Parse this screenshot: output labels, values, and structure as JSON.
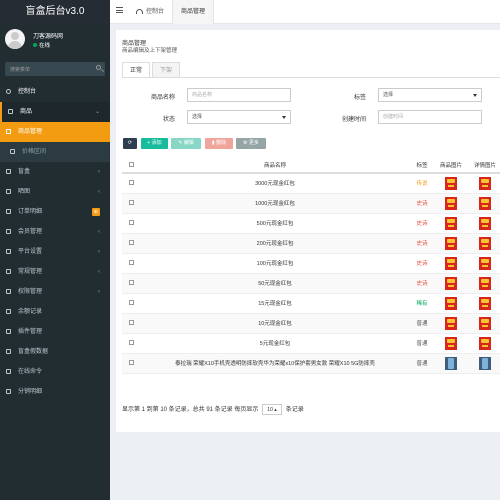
{
  "app": {
    "title": "盲盒后台v3.0"
  },
  "user": {
    "name": "刀客源码网",
    "status": "在线"
  },
  "search": {
    "placeholder": "搜索菜单"
  },
  "sidebar": {
    "items": [
      {
        "label": "控制台"
      },
      {
        "label": "商品"
      },
      {
        "label": "商品管理"
      },
      {
        "label": "价格区间"
      },
      {
        "label": "盲盒"
      },
      {
        "label": "晒图"
      },
      {
        "label": "订单明细",
        "badge": "新"
      },
      {
        "label": "会员管理"
      },
      {
        "label": "平台设置"
      },
      {
        "label": "常规管理"
      },
      {
        "label": "权限管理"
      },
      {
        "label": "余额记录"
      },
      {
        "label": "插件管理"
      },
      {
        "label": "盲盒假数据"
      },
      {
        "label": "在线命令"
      },
      {
        "label": "分销明细"
      }
    ]
  },
  "topnav": {
    "tab1": "控制台",
    "tab2": "商品管理"
  },
  "panel": {
    "title": "商品管理",
    "desc": "商品编辑及上下架管理",
    "tabs": [
      "正常",
      "下架"
    ]
  },
  "filters": {
    "name_label": "商品名称",
    "name_placeholder": "商品名称",
    "tag_label": "标签",
    "tag_value": "选择",
    "status_label": "状态",
    "status_value": "选择",
    "created_label": "创建时间",
    "created_placeholder": "创建时间"
  },
  "toolbar": {
    "refresh": "",
    "add": "添加",
    "edit": "编辑",
    "delete": "删除",
    "more": "更多"
  },
  "table": {
    "headers": [
      "商品名称",
      "标签",
      "商品图片",
      "详情图片"
    ],
    "rows": [
      {
        "name": "3000元现金红包",
        "tag": "传说",
        "tagClass": "tag-orange",
        "img": "red"
      },
      {
        "name": "1000元现金红包",
        "tag": "史诗",
        "tagClass": "tag-red",
        "img": "red"
      },
      {
        "name": "500元现金红包",
        "tag": "史诗",
        "tagClass": "tag-red",
        "img": "red"
      },
      {
        "name": "200元现金红包",
        "tag": "史诗",
        "tagClass": "tag-red",
        "img": "red"
      },
      {
        "name": "100元现金红包",
        "tag": "史诗",
        "tagClass": "tag-red",
        "img": "red"
      },
      {
        "name": "50元现金红包",
        "tag": "史诗",
        "tagClass": "tag-red",
        "img": "red"
      },
      {
        "name": "15元现金红包",
        "tag": "稀有",
        "tagClass": "tag-green",
        "img": "red"
      },
      {
        "name": "10元现金红包",
        "tag": "普通",
        "tagClass": "tag-gray",
        "img": "red"
      },
      {
        "name": "5元现金红包",
        "tag": "普通",
        "tagClass": "tag-gray",
        "img": "red"
      },
      {
        "name": "泰拉瑞 荣耀X10手机壳透明防摔软壳华为荣耀x10保护套男女款 荣耀X10 5G防摔壳",
        "tag": "普通",
        "tagClass": "tag-gray",
        "img": "phone"
      }
    ]
  },
  "footer": {
    "text1": "显示第 1 到第 10 条记录，总共 91 条记录 每页显示",
    "page_size": "10",
    "text2": "条记录"
  }
}
